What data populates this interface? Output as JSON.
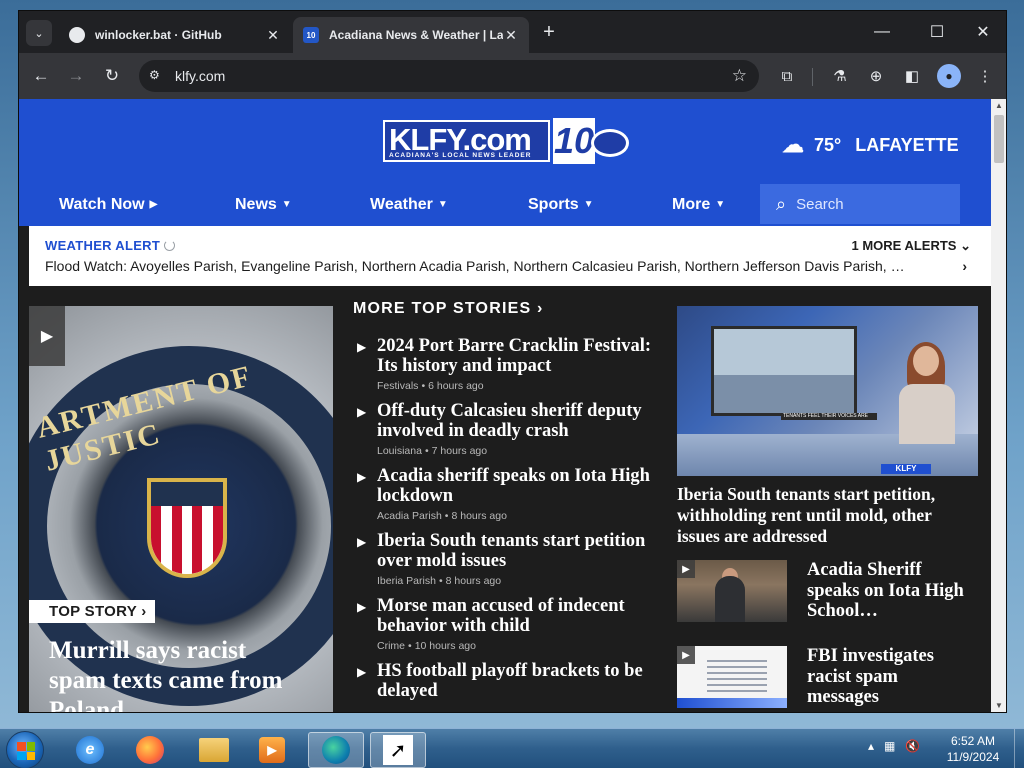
{
  "browser": {
    "tabs": [
      {
        "title": "winlocker.bat · GitHub",
        "favicon": "github-icon",
        "active": false
      },
      {
        "title": "Acadiana News & Weather | Lafayette",
        "favicon": "klfy-icon",
        "active": true
      }
    ],
    "address": "klfy.com",
    "new_tab_symbol": "+",
    "favicon_text": "10"
  },
  "site": {
    "logo_text": "KLFY.com",
    "logo_tagline": "ACADIANA'S LOCAL NEWS LEADER",
    "logo_channel": "10",
    "weather": {
      "temp": "75°",
      "city": "LAFAYETTE",
      "icon": "cloud-icon"
    },
    "nav": [
      {
        "label": "Watch Now",
        "suffix": "▶"
      },
      {
        "label": "News",
        "suffix": "▼"
      },
      {
        "label": "Weather",
        "suffix": "▼"
      },
      {
        "label": "Sports",
        "suffix": "▼"
      },
      {
        "label": "More",
        "suffix": "▼"
      }
    ],
    "search_placeholder": "Search"
  },
  "alert": {
    "label": "WEATHER ALERT",
    "more": "1 MORE ALERTS",
    "text": "Flood Watch: Avoyelles Parish, Evangeline Parish, Northern Acadia Parish, Northern Calcasieu Parish, Northern Jefferson Davis Parish, …"
  },
  "hero": {
    "badge": "TOP STORY",
    "title": "Murrill says racist spam texts came from Poland",
    "seal_text": "ARTMENT OF JUSTIC"
  },
  "more_top_stories": {
    "heading": "MORE TOP STORIES",
    "items": [
      {
        "headline": "2024 Port Barre Cracklin Festival: Its history and impact",
        "category": "Festivals",
        "time": "6 hours ago"
      },
      {
        "headline": "Off-duty Calcasieu sheriff deputy involved in deadly crash",
        "category": "Louisiana",
        "time": "7 hours ago"
      },
      {
        "headline": "Acadia sheriff speaks on Iota High lockdown",
        "category": "Acadia Parish",
        "time": "8 hours ago"
      },
      {
        "headline": "Iberia South tenants start petition over mold issues",
        "category": "Iberia Parish",
        "time": "8 hours ago"
      },
      {
        "headline": "Morse man accused of indecent behavior with child",
        "category": "Crime",
        "time": "10 hours ago"
      },
      {
        "headline": "HS football playoff brackets to be delayed",
        "category": "",
        "time": ""
      }
    ]
  },
  "feature": {
    "title": "Iberia South tenants start petition, withholding rent until mold, other issues are addressed",
    "chyron": "TENANTS FEEL THEIR VOICES ARE",
    "desk_logo": "KLFY"
  },
  "side_stories": [
    {
      "title": "Acadia Sheriff speaks on Iota High School…",
      "thumb": "office"
    },
    {
      "title": "FBI investigates racist spam messages",
      "thumb": "document"
    }
  ],
  "taskbar": {
    "apps": [
      "internet-explorer",
      "firefox",
      "file-explorer",
      "media-player",
      "browser-active",
      "cursor-app"
    ],
    "time": "6:52 AM",
    "date": "11/9/2024"
  },
  "colors": {
    "brand_blue": "#1f4fd0",
    "page_dark": "#1d1d1d",
    "chrome_dark": "#202124"
  }
}
